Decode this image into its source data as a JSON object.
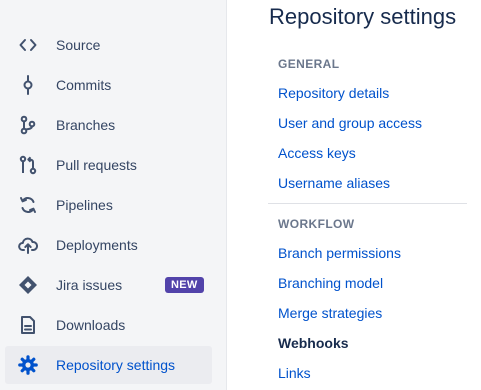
{
  "colors": {
    "sidebar_bg": "#f4f5f7",
    "active_item_bg": "#ebecf0",
    "link": "#0052cc",
    "text": "#172b4d",
    "muted": "#6b778c",
    "badge_bg": "#5243aa"
  },
  "sidebar": {
    "items": [
      {
        "label": "Source",
        "icon": "code-icon",
        "active": false
      },
      {
        "label": "Commits",
        "icon": "commit-icon",
        "active": false
      },
      {
        "label": "Branches",
        "icon": "branch-icon",
        "active": false
      },
      {
        "label": "Pull requests",
        "icon": "pull-request-icon",
        "active": false
      },
      {
        "label": "Pipelines",
        "icon": "refresh-icon",
        "active": false
      },
      {
        "label": "Deployments",
        "icon": "cloud-upload-icon",
        "active": false
      },
      {
        "label": "Jira issues",
        "icon": "jira-icon",
        "active": false,
        "badge": "NEW"
      },
      {
        "label": "Downloads",
        "icon": "document-icon",
        "active": false
      },
      {
        "label": "Repository settings",
        "icon": "gear-icon",
        "active": true
      }
    ]
  },
  "main": {
    "title": "Repository settings",
    "sections": [
      {
        "heading": "GENERAL",
        "links": [
          {
            "label": "Repository details",
            "current": false
          },
          {
            "label": "User and group access",
            "current": false
          },
          {
            "label": "Access keys",
            "current": false
          },
          {
            "label": "Username aliases",
            "current": false
          }
        ]
      },
      {
        "heading": "WORKFLOW",
        "links": [
          {
            "label": "Branch permissions",
            "current": false
          },
          {
            "label": "Branching model",
            "current": false
          },
          {
            "label": "Merge strategies",
            "current": false
          },
          {
            "label": "Webhooks",
            "current": true
          },
          {
            "label": "Links",
            "current": false
          }
        ]
      }
    ]
  }
}
